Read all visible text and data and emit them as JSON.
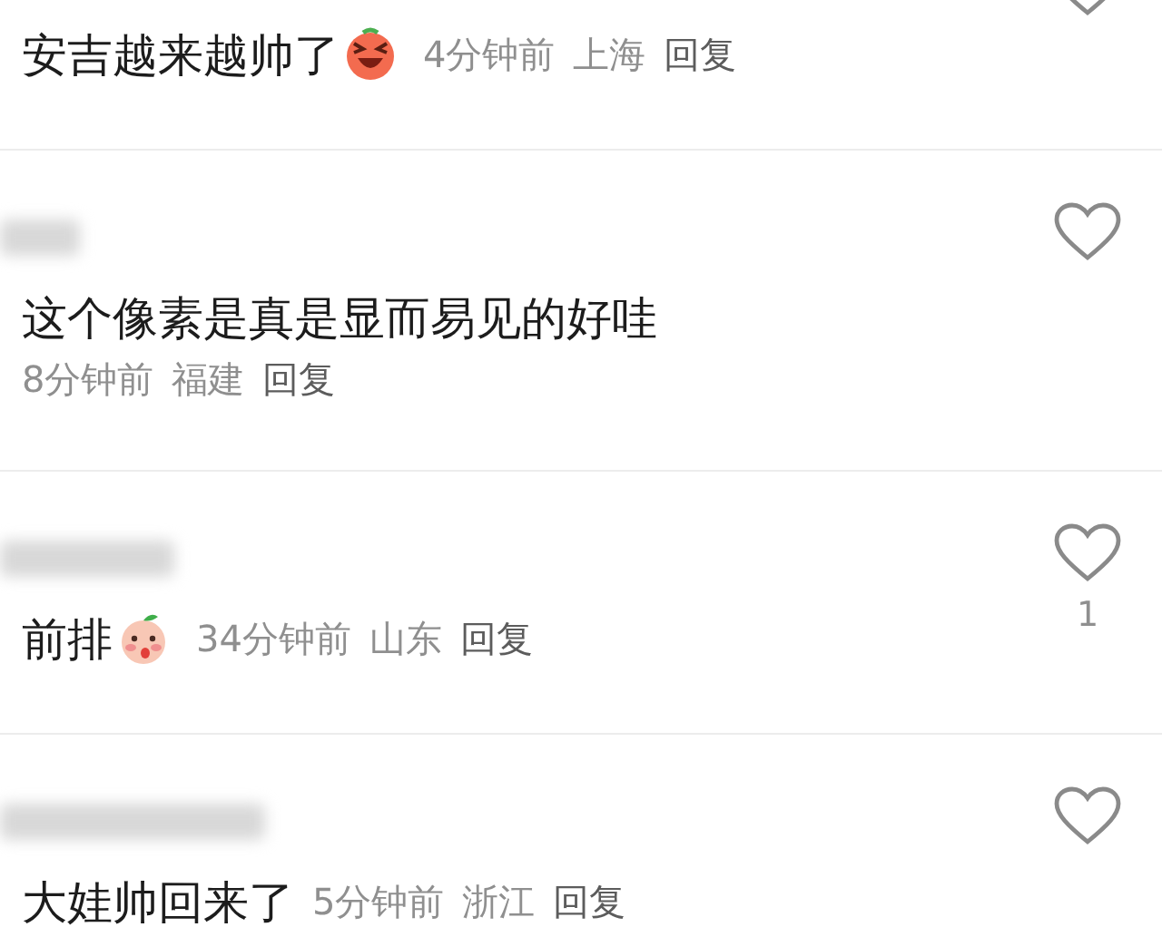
{
  "comments": [
    {
      "kind": "inline",
      "text": "安吉越来越帅了",
      "emoji": {
        "kind": "laughing"
      },
      "time": "4分钟前",
      "location": "上海",
      "reply": "回复"
    },
    {
      "kind": "two_line",
      "username": {
        "kind": "blurred"
      },
      "text": "这个像素是真是显而易见的好哇",
      "time": "8分钟前",
      "location": "福建",
      "reply": "回复"
    },
    {
      "kind": "inline",
      "username": {
        "kind": "blurred"
      },
      "text": "前排",
      "emoji": {
        "kind": "blushing"
      },
      "time": "34分钟前",
      "location": "山东",
      "reply": "回复",
      "likes": "1"
    },
    {
      "kind": "inline",
      "username": {
        "kind": "blurred"
      },
      "text": "大娃帅回来了",
      "time": "5分钟前",
      "location": "浙江",
      "reply": "回复"
    }
  ]
}
